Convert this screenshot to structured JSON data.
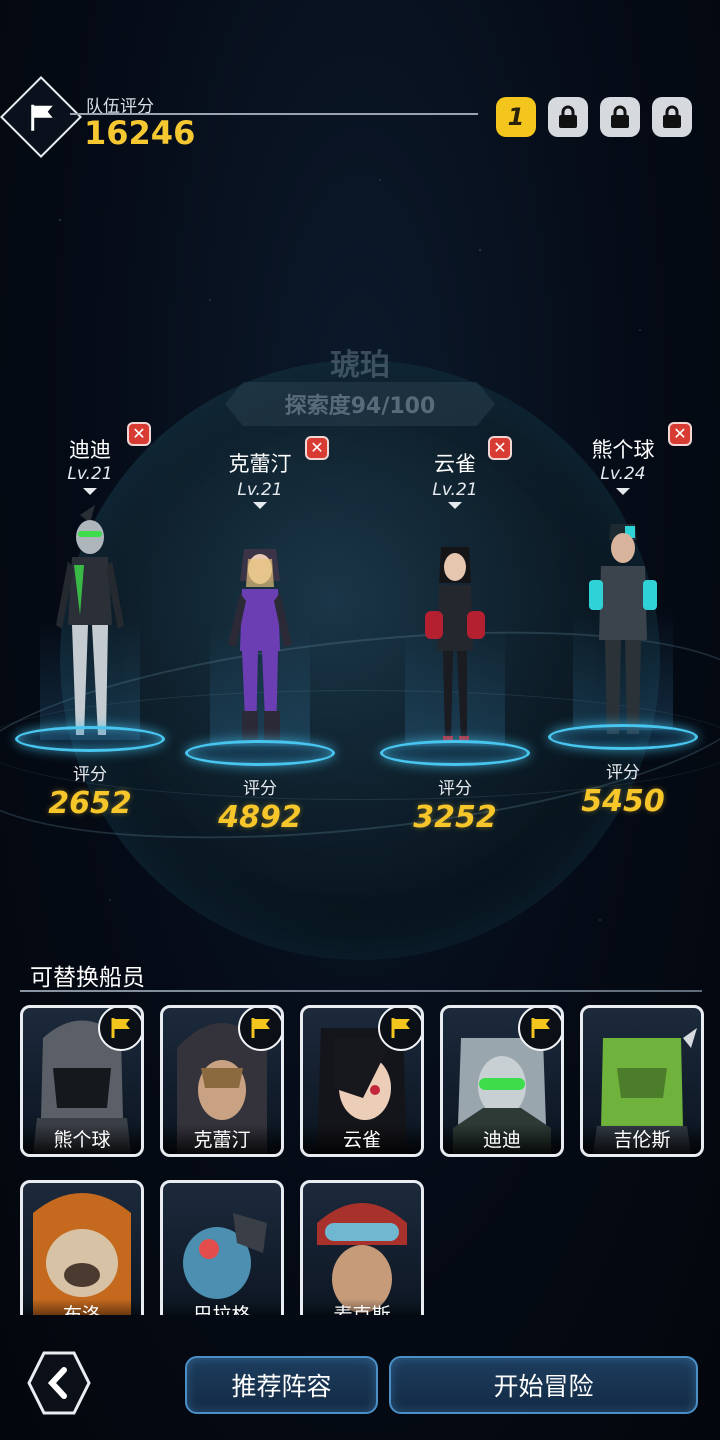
{
  "team": {
    "label": "队伍评分",
    "score": "16246",
    "slots": [
      {
        "label": "1",
        "state": "active"
      },
      {
        "state": "locked",
        "icon": "lock-icon"
      },
      {
        "state": "locked",
        "icon": "lock-icon"
      },
      {
        "state": "locked",
        "icon": "lock-icon"
      }
    ]
  },
  "planet": {
    "name": "琥珀",
    "exploration": "探索度94/100"
  },
  "lineup": [
    {
      "name": "迪迪",
      "level": "Lv.21",
      "score_label": "评分",
      "score": "2652",
      "accent": "#3ddc4a"
    },
    {
      "name": "克蕾汀",
      "level": "Lv.21",
      "score_label": "评分",
      "score": "4892",
      "accent": "#7a3fc2"
    },
    {
      "name": "云雀",
      "level": "Lv.21",
      "score_label": "评分",
      "score": "3252",
      "accent": "#d8283a"
    },
    {
      "name": "熊个球",
      "level": "Lv.24",
      "score_label": "评分",
      "score": "5450",
      "accent": "#2fd2d6"
    }
  ],
  "crew": {
    "title": "可替换船员",
    "members": [
      {
        "name": "熊个球",
        "in_team": true
      },
      {
        "name": "克蕾汀",
        "in_team": true
      },
      {
        "name": "云雀",
        "in_team": true
      },
      {
        "name": "迪迪",
        "in_team": true
      },
      {
        "name": "吉伦斯",
        "in_team": false
      },
      {
        "name": "布洛",
        "in_team": false
      },
      {
        "name": "巴拉格",
        "in_team": false
      },
      {
        "name": "麦克斯",
        "in_team": false
      }
    ]
  },
  "buttons": {
    "recommend": "推荐阵容",
    "start": "开始冒险"
  },
  "colors": {
    "gold": "#f6c62a",
    "pad_glow": "#49c6f0",
    "remove": "#d73b32"
  }
}
